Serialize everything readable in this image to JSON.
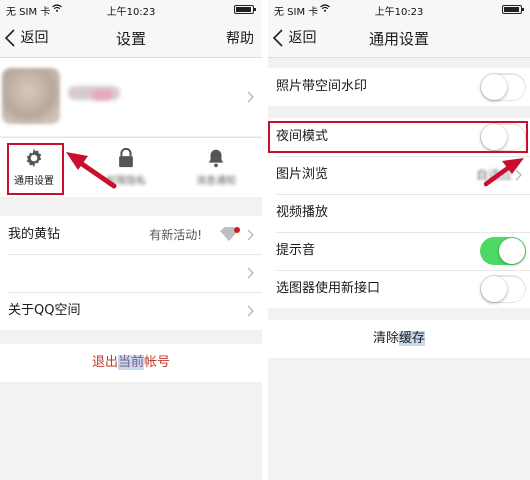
{
  "left_screen": {
    "status": {
      "carrier": "无 SIM 卡",
      "time": "上午10:23",
      "battery_level": 0.9
    },
    "navbar": {
      "back_label": "返回",
      "title": "设置",
      "help_label": "帮助"
    },
    "quick_icons": [
      {
        "label": "通用设置",
        "icon": "gear-icon"
      },
      {
        "label": "权限隐私",
        "icon": "lock-icon"
      },
      {
        "label": "消息通知",
        "icon": "bell-icon"
      }
    ],
    "rows": {
      "vip_label": "我的黄钻",
      "vip_note": "有新活动!",
      "about_label": "关于QQ空间",
      "logout_label_pre": "退出",
      "logout_label_highlight": "当前",
      "logout_label_post": "帐号"
    }
  },
  "right_screen": {
    "status": {
      "carrier": "无 SIM 卡",
      "time": "上午10:23",
      "battery_level": 0.9
    },
    "navbar": {
      "back_label": "返回",
      "title": "通用设置"
    },
    "settings": [
      {
        "label": "照片带空间水印",
        "toggle_on": false
      },
      {
        "label": "夜间模式",
        "toggle_on": false
      },
      {
        "label": "图片浏览",
        "value": "自适应"
      },
      {
        "label": "视频播放"
      },
      {
        "label": "提示音",
        "toggle_on": true
      },
      {
        "label": "选图器使用新接口",
        "toggle_on": false
      }
    ],
    "clear_cache": {
      "label_pre": "清除",
      "label_highlight": "缓存"
    }
  },
  "colors": {
    "accent_red": "#c8102e",
    "toggle_on": "#4cd964",
    "logout_text": "#c0392b"
  }
}
